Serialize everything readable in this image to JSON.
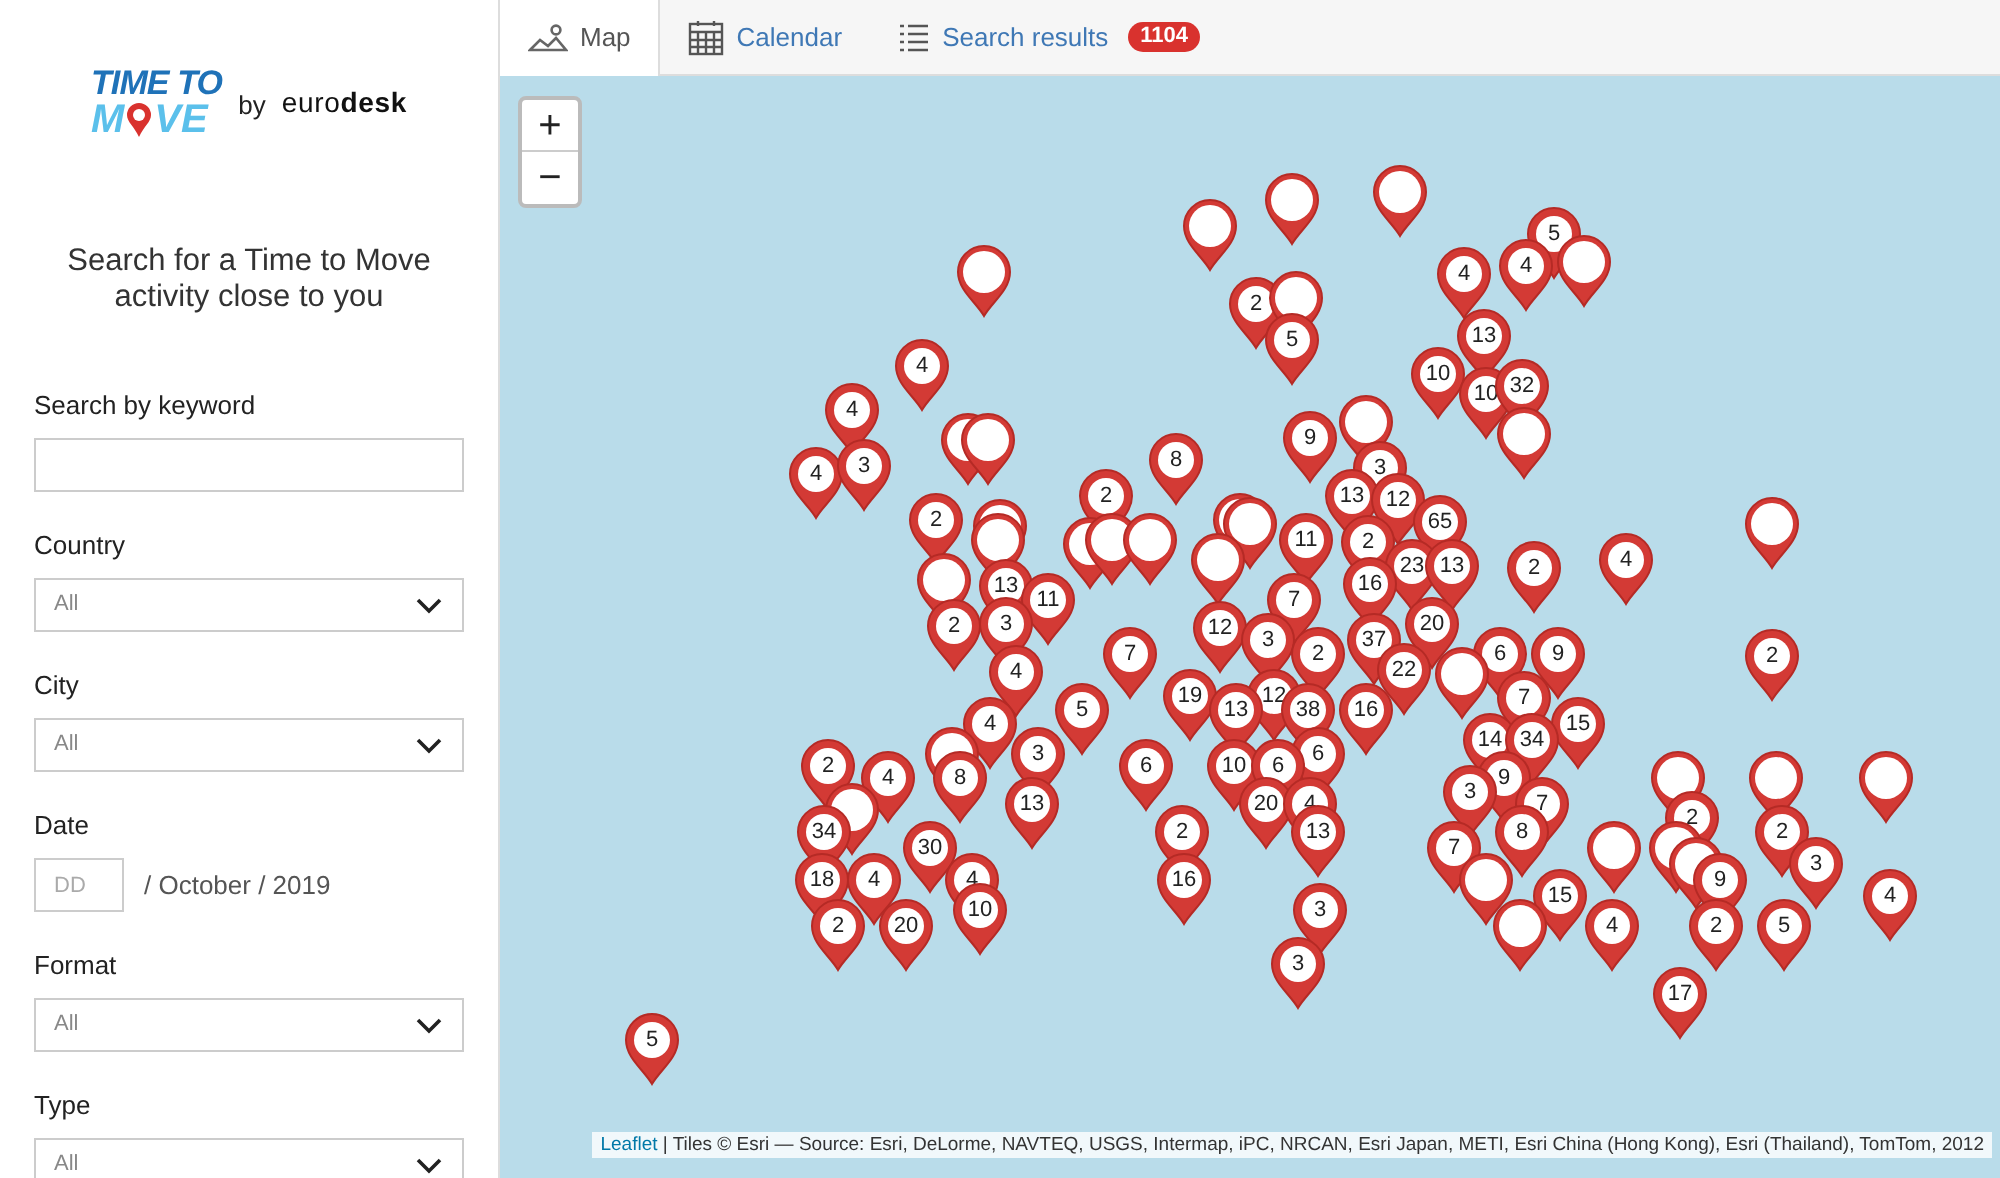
{
  "sidebar": {
    "logo": {
      "line1": "TIME TO",
      "line2_start": "M",
      "line2_end": "VE",
      "by": "by",
      "brand": "euro**desk**"
    },
    "heading": "Search for a Time to Move activity close to you",
    "fields": [
      {
        "kind": "text",
        "label": "Search by keyword"
      },
      {
        "kind": "select",
        "label": "Country",
        "value": "All"
      },
      {
        "kind": "select",
        "label": "City",
        "value": "All"
      },
      {
        "kind": "date",
        "label": "Date",
        "placeholder": "DD",
        "suffix": "/ October / 2019"
      },
      {
        "kind": "select",
        "label": "Format",
        "value": "All"
      },
      {
        "kind": "select",
        "label": "Type",
        "value": "All"
      }
    ]
  },
  "tabs": [
    {
      "kind": "map",
      "label": "Map",
      "selected": true
    },
    {
      "kind": "calendar",
      "label": "Calendar",
      "selected": false
    },
    {
      "kind": "list",
      "label": "Search results",
      "selected": false,
      "badge": "1104"
    }
  ],
  "map": {
    "zoom_in": "+",
    "zoom_out": "−",
    "attribution_link": "Leaflet",
    "attribution_text": " | Tiles © Esri — Source: Esri, DeLorme, NAVTEQ, USGS, Intermap, iPC, NRCAN, Esri Japan, METI, Esri China (Hong Kong), Esri (Thailand), TomTom, 2012",
    "markers": [
      {
        "kind": "plain"
      },
      {
        "kind": "plain"
      },
      {
        "kind": "plain"
      },
      {
        "kind": "count",
        "label": "5"
      },
      {
        "kind": "plain"
      },
      {
        "kind": "count",
        "label": "4"
      },
      {
        "kind": "count",
        "label": "4"
      },
      {
        "kind": "plain"
      },
      {
        "kind": "count",
        "label": "2"
      },
      {
        "kind": "plain"
      },
      {
        "kind": "count",
        "label": "5"
      },
      {
        "kind": "count",
        "label": "13"
      },
      {
        "kind": "count",
        "label": "4"
      },
      {
        "kind": "count",
        "label": "10"
      },
      {
        "kind": "count",
        "label": "10"
      },
      {
        "kind": "count",
        "label": "32"
      },
      {
        "kind": "count",
        "label": "4"
      },
      {
        "kind": "plain"
      },
      {
        "kind": "plain"
      },
      {
        "kind": "plain"
      },
      {
        "kind": "plain"
      },
      {
        "kind": "count",
        "label": "9"
      },
      {
        "kind": "count",
        "label": "4"
      },
      {
        "kind": "count",
        "label": "3"
      },
      {
        "kind": "count",
        "label": "8"
      },
      {
        "kind": "count",
        "label": "3"
      },
      {
        "kind": "count",
        "label": "2"
      },
      {
        "kind": "count",
        "label": "13"
      },
      {
        "kind": "count",
        "label": "12"
      },
      {
        "kind": "count",
        "label": "2"
      },
      {
        "kind": "plain"
      },
      {
        "kind": "plain"
      },
      {
        "kind": "plain"
      },
      {
        "kind": "count",
        "label": "65"
      },
      {
        "kind": "plain"
      },
      {
        "kind": "plain"
      },
      {
        "kind": "plain"
      },
      {
        "kind": "plain"
      },
      {
        "kind": "plain"
      },
      {
        "kind": "count",
        "label": "11"
      },
      {
        "kind": "count",
        "label": "2"
      },
      {
        "kind": "plain"
      },
      {
        "kind": "count",
        "label": "23"
      },
      {
        "kind": "count",
        "label": "13"
      },
      {
        "kind": "count",
        "label": "2"
      },
      {
        "kind": "count",
        "label": "4"
      },
      {
        "kind": "plain"
      },
      {
        "kind": "count",
        "label": "13"
      },
      {
        "kind": "count",
        "label": "16"
      },
      {
        "kind": "count",
        "label": "11"
      },
      {
        "kind": "count",
        "label": "7"
      },
      {
        "kind": "count",
        "label": "2"
      },
      {
        "kind": "count",
        "label": "3"
      },
      {
        "kind": "count",
        "label": "12"
      },
      {
        "kind": "count",
        "label": "20"
      },
      {
        "kind": "count",
        "label": "3"
      },
      {
        "kind": "count",
        "label": "37"
      },
      {
        "kind": "count",
        "label": "7"
      },
      {
        "kind": "count",
        "label": "2"
      },
      {
        "kind": "count",
        "label": "6"
      },
      {
        "kind": "count",
        "label": "9"
      },
      {
        "kind": "count",
        "label": "2"
      },
      {
        "kind": "count",
        "label": "4"
      },
      {
        "kind": "count",
        "label": "22"
      },
      {
        "kind": "plain"
      },
      {
        "kind": "count",
        "label": "19"
      },
      {
        "kind": "count",
        "label": "12"
      },
      {
        "kind": "count",
        "label": "7"
      },
      {
        "kind": "count",
        "label": "5"
      },
      {
        "kind": "count",
        "label": "13"
      },
      {
        "kind": "count",
        "label": "38"
      },
      {
        "kind": "count",
        "label": "16"
      },
      {
        "kind": "count",
        "label": "4"
      },
      {
        "kind": "count",
        "label": "15"
      },
      {
        "kind": "count",
        "label": "14"
      },
      {
        "kind": "count",
        "label": "34"
      },
      {
        "kind": "plain"
      },
      {
        "kind": "count",
        "label": "3"
      },
      {
        "kind": "count",
        "label": "6"
      },
      {
        "kind": "count",
        "label": "2"
      },
      {
        "kind": "count",
        "label": "6"
      },
      {
        "kind": "count",
        "label": "10"
      },
      {
        "kind": "count",
        "label": "6"
      },
      {
        "kind": "count",
        "label": "4"
      },
      {
        "kind": "count",
        "label": "8"
      },
      {
        "kind": "count",
        "label": "9"
      },
      {
        "kind": "plain"
      },
      {
        "kind": "plain"
      },
      {
        "kind": "plain"
      },
      {
        "kind": "count",
        "label": "3"
      },
      {
        "kind": "plain"
      },
      {
        "kind": "count",
        "label": "13"
      },
      {
        "kind": "count",
        "label": "20"
      },
      {
        "kind": "count",
        "label": "4"
      },
      {
        "kind": "count",
        "label": "7"
      },
      {
        "kind": "count",
        "label": "2"
      },
      {
        "kind": "count",
        "label": "34"
      },
      {
        "kind": "count",
        "label": "2"
      },
      {
        "kind": "count",
        "label": "13"
      },
      {
        "kind": "count",
        "label": "8"
      },
      {
        "kind": "count",
        "label": "2"
      },
      {
        "kind": "count",
        "label": "30"
      },
      {
        "kind": "count",
        "label": "7"
      },
      {
        "kind": "plain"
      },
      {
        "kind": "plain"
      },
      {
        "kind": "plain"
      },
      {
        "kind": "count",
        "label": "3"
      },
      {
        "kind": "count",
        "label": "18"
      },
      {
        "kind": "count",
        "label": "4"
      },
      {
        "kind": "count",
        "label": "4"
      },
      {
        "kind": "count",
        "label": "16"
      },
      {
        "kind": "plain"
      },
      {
        "kind": "count",
        "label": "9"
      },
      {
        "kind": "count",
        "label": "15"
      },
      {
        "kind": "count",
        "label": "4"
      },
      {
        "kind": "count",
        "label": "10"
      },
      {
        "kind": "count",
        "label": "3"
      },
      {
        "kind": "count",
        "label": "2"
      },
      {
        "kind": "count",
        "label": "20"
      },
      {
        "kind": "plain"
      },
      {
        "kind": "count",
        "label": "4"
      },
      {
        "kind": "count",
        "label": "2"
      },
      {
        "kind": "count",
        "label": "5"
      },
      {
        "kind": "count",
        "label": "3"
      },
      {
        "kind": "count",
        "label": "17"
      },
      {
        "kind": "count",
        "label": "5"
      }
    ]
  }
}
